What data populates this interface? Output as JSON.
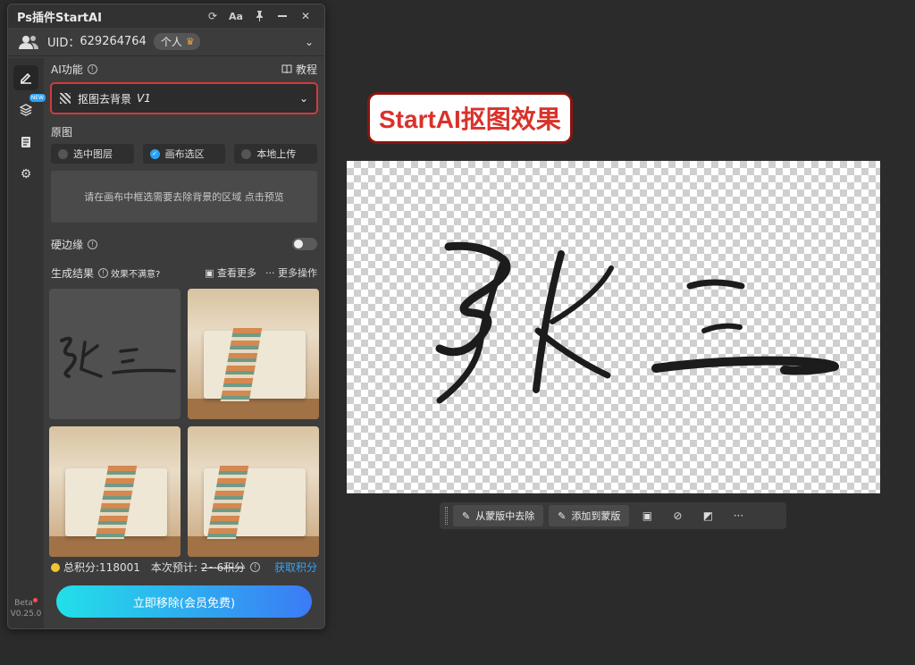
{
  "window": {
    "title": "Ps插件StartAI"
  },
  "user": {
    "uid_label": "UID：",
    "uid": "629264764",
    "account_type": "个人"
  },
  "ai": {
    "section_label": "AI功能",
    "tutorial_label": "教程",
    "function_selected": "抠图去背景",
    "function_version": "V1"
  },
  "source": {
    "section_label": "原图",
    "options": [
      "选中图层",
      "画布选区",
      "本地上传"
    ],
    "selected_index": 1,
    "hint": "请在画布中框选需要去除背景的区域 点击预览"
  },
  "hard_edge": {
    "label": "硬边缘",
    "enabled": false
  },
  "results": {
    "label": "生成结果",
    "dissatisfied": "效果不满意?",
    "view_more": "查看更多",
    "more_actions": "更多操作"
  },
  "points": {
    "total_label": "总积分:118001",
    "estimate_label": "本次预计:",
    "estimate_value": "2~6积分",
    "get_points": "获取积分"
  },
  "cta": {
    "label": "立即移除(会员免费)"
  },
  "sidebar": {
    "beta_label": "Beta",
    "version": "V0.25.0",
    "new_tag": "NEW"
  },
  "canvas": {
    "effect_title": "StartAI抠图效果",
    "signature_text": "张三"
  },
  "float_toolbar": {
    "remove_from_mask": "从蒙版中去除",
    "add_to_mask": "添加到蒙版"
  },
  "colors": {
    "accent_blue": "#2aa3f4",
    "highlight_red": "#d43a3a",
    "cta_start": "#22e0e8",
    "cta_end": "#3b7bf6"
  }
}
